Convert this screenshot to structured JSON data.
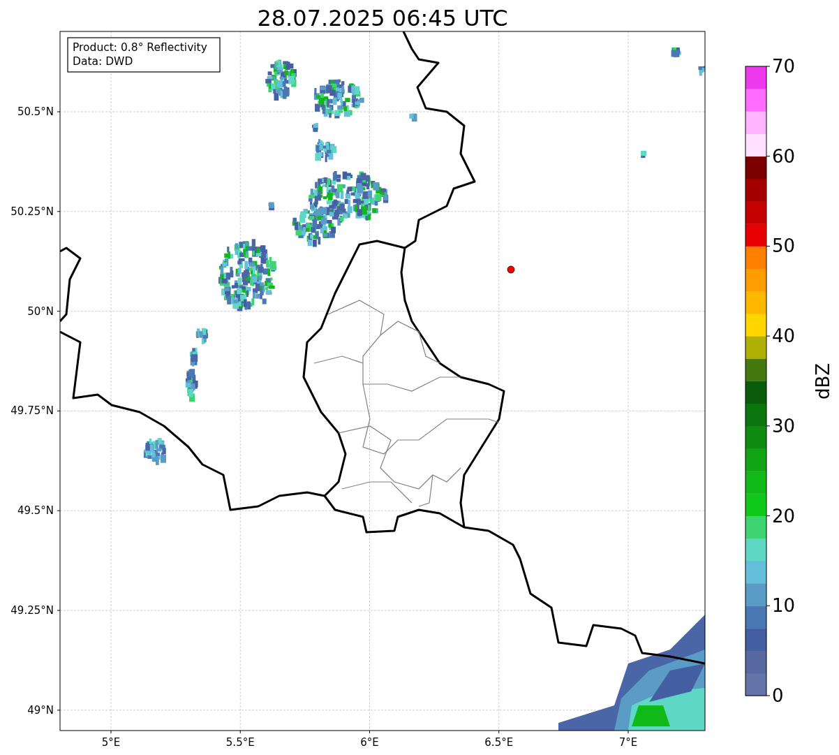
{
  "title": "28.07.2025 06:45 UTC",
  "map": {
    "info": [
      "Product: 0.8° Reflectivity",
      "Data: DWD"
    ],
    "lat_ticks": [
      "50.5°N",
      "50.25°N",
      "50°N",
      "49.75°N",
      "49.5°N",
      "49.25°N",
      "49°N"
    ],
    "lon_ticks": [
      "5°E",
      "5.5°E",
      "6°E",
      "6.5°E",
      "7°E"
    ]
  },
  "colorbar": {
    "label": "dBZ",
    "ticks": [
      "70",
      "60",
      "50",
      "40",
      "30",
      "20",
      "10",
      "0"
    ],
    "bins": [
      {
        "color": "#6474a8"
      },
      {
        "color": "#5868a0"
      },
      {
        "color": "#445ea2"
      },
      {
        "color": "#4a78b2"
      },
      {
        "color": "#5a9cc6"
      },
      {
        "color": "#64c0da"
      },
      {
        "color": "#5ed8c4"
      },
      {
        "color": "#3ed470"
      },
      {
        "color": "#10c81a"
      },
      {
        "color": "#10b818"
      },
      {
        "color": "#10a414"
      },
      {
        "color": "#0e8c12"
      },
      {
        "color": "#0c760e"
      },
      {
        "color": "#0a5c0a"
      },
      {
        "color": "#467810"
      },
      {
        "color": "#b0b004"
      },
      {
        "color": "#ffd600"
      },
      {
        "color": "#ffb800"
      },
      {
        "color": "#ff9c00"
      },
      {
        "color": "#ff8000"
      },
      {
        "color": "#e60000"
      },
      {
        "color": "#c40000"
      },
      {
        "color": "#a40000"
      },
      {
        "color": "#7c0000"
      },
      {
        "color": "#ffe0ff"
      },
      {
        "color": "#ffb4ff"
      },
      {
        "color": "#ff6cff"
      },
      {
        "color": "#ee38ee"
      }
    ]
  }
}
